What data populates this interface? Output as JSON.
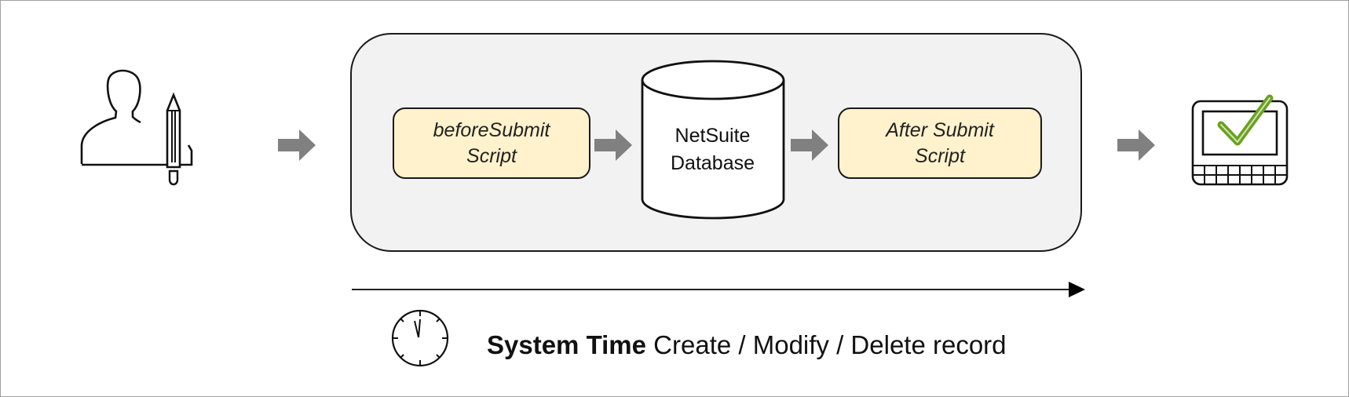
{
  "steps": {
    "before_submit": {
      "line1": "beforeSubmit",
      "line2": "Script"
    },
    "database": {
      "line1": "NetSuite",
      "line2": "Database"
    },
    "after_submit": {
      "line1": "After Submit",
      "line2": "Script"
    }
  },
  "timeline": {
    "bold_label": "System Time",
    "label": " Create / Modify / Delete record"
  },
  "icons": [
    "user-edit-icon",
    "arrow-right-icon",
    "database-cylinder-icon",
    "device-checkmark-icon",
    "clock-icon"
  ],
  "colors": {
    "script_fill": "#fff2cc",
    "panel_fill": "#f2f2f2",
    "arrow": "#808080",
    "check": "#6aa121"
  }
}
